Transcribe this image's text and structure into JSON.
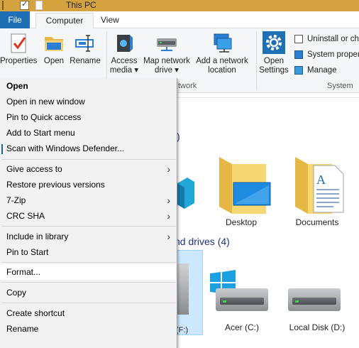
{
  "window": {
    "title": "This PC"
  },
  "tabs": {
    "file": "File",
    "computer": "Computer",
    "view": "View"
  },
  "ribbon": {
    "buttons": [
      {
        "label": "Properties",
        "icon": "properties-icon"
      },
      {
        "label": "Open",
        "icon": "open-folder-icon"
      },
      {
        "label": "Rename",
        "icon": "rename-icon"
      },
      {
        "label": "Access media ▾",
        "icon": "access-media-icon"
      },
      {
        "label": "Map network drive ▾",
        "icon": "map-network-drive-icon"
      },
      {
        "label": "Add a network location",
        "icon": "add-network-location-icon"
      },
      {
        "label": "Open Settings",
        "icon": "settings-gear-icon"
      }
    ],
    "system_items": [
      "Uninstall or ch",
      "System proper",
      "Manage"
    ],
    "group_labels": {
      "network": "twork",
      "system": "System"
    }
  },
  "content": {
    "folders_header": ")",
    "drives_header": "nd drives (4)",
    "folders": [
      {
        "name": "Desktop",
        "icon": "desktop-folder-icon"
      },
      {
        "name": "Documents",
        "icon": "documents-folder-icon"
      }
    ],
    "drives": [
      {
        "name": "(F:)",
        "icon": "usb-drive-icon"
      },
      {
        "name": "Acer (C:)",
        "icon": "windows-drive-icon"
      },
      {
        "name": "Local Disk (D:)",
        "icon": "hard-drive-icon"
      }
    ]
  },
  "context_menu": {
    "items": [
      {
        "label": "Open",
        "bold": true
      },
      {
        "label": "Open in new window"
      },
      {
        "label": "Pin to Quick access"
      },
      {
        "label": "Add to Start menu"
      },
      {
        "label": "Scan with Windows Defender..."
      },
      {
        "label": "Give access to",
        "submenu": true
      },
      {
        "label": "Restore previous versions"
      },
      {
        "label": "7-Zip",
        "submenu": true
      },
      {
        "label": "CRC SHA",
        "submenu": true
      },
      {
        "label": "Include in library",
        "submenu": true
      },
      {
        "label": "Pin to Start"
      },
      {
        "label": "Format..."
      },
      {
        "label": "Copy"
      },
      {
        "label": "Create shortcut"
      },
      {
        "label": "Rename"
      }
    ],
    "submenu_arrow": "›"
  },
  "colors": {
    "accent": "#1e6fb3",
    "titlebar": "#d4a33f",
    "menu_bg": "#f2f2f2",
    "selection": "#cce8ff"
  }
}
